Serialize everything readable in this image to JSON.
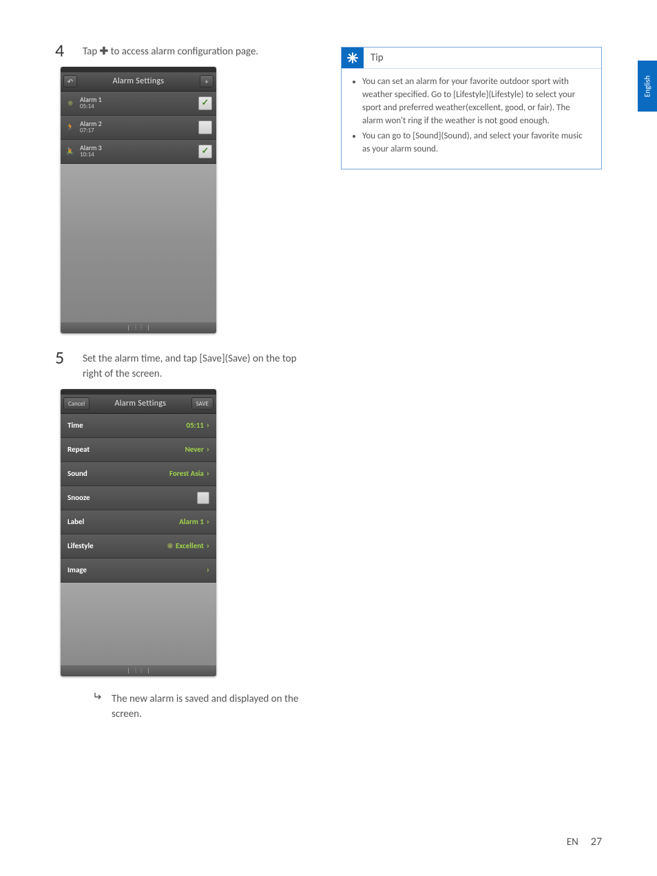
{
  "language_tab": "English",
  "steps": {
    "s4": {
      "num": "4",
      "text_before": "Tap ",
      "text_after": " to access alarm configuration page."
    },
    "s5": {
      "num": "5",
      "text": "Set the alarm time, and tap [Save](Save) on the top right of the screen."
    }
  },
  "result": "The new alarm is saved and displayed on the screen.",
  "shot1": {
    "title": "Alarm Settings",
    "add": "+",
    "alarms": [
      {
        "name": "Alarm 1",
        "time": "05:14",
        "checked": true
      },
      {
        "name": "Alarm 2",
        "time": "07:17",
        "checked": false
      },
      {
        "name": "Alarm 3",
        "time": "10:14",
        "checked": true
      }
    ]
  },
  "shot2": {
    "cancel": "Cancel",
    "title": "Alarm Settings",
    "save": "SAVE",
    "rows": {
      "time": {
        "label": "Time",
        "value": "05:11"
      },
      "repeat": {
        "label": "Repeat",
        "value": "Never"
      },
      "sound": {
        "label": "Sound",
        "value": "Forest Asia"
      },
      "snooze": {
        "label": "Snooze"
      },
      "labelrow": {
        "label": "Label",
        "value": "Alarm 1"
      },
      "lifestyle": {
        "label": "Lifestyle",
        "value": "Excellent"
      },
      "image": {
        "label": "Image"
      }
    }
  },
  "tip": {
    "title": "Tip",
    "items": [
      "You can set an alarm for your favorite outdoor sport with weather specified. Go to [Lifestyle](Lifestyle) to select your sport and preferred weather(excellent, good, or fair). The alarm won't ring if the weather is not good enough.",
      "You can go to [Sound](Sound), and select your favorite music as your alarm sound."
    ]
  },
  "footer": {
    "lang": "EN",
    "page": "27"
  }
}
